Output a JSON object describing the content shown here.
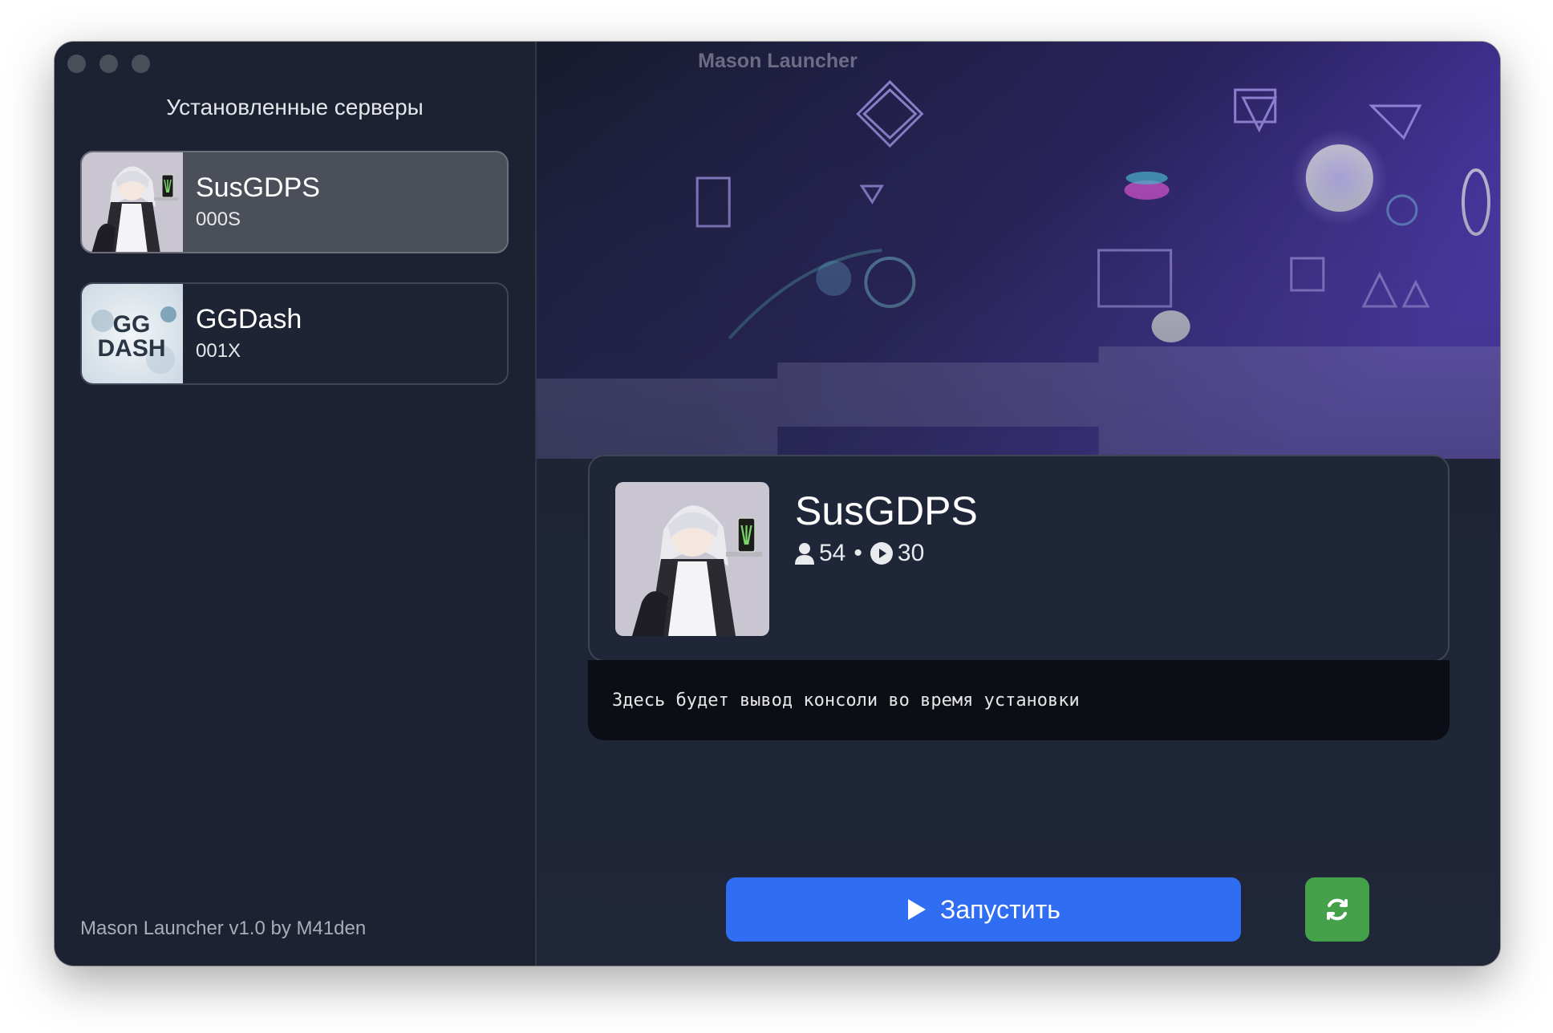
{
  "window": {
    "title": "Mason Launcher"
  },
  "sidebar": {
    "title": "Установленные серверы",
    "servers": [
      {
        "name": "SusGDPS",
        "code": "000S",
        "selected": true,
        "thumb": "maid-character-thumbnail"
      },
      {
        "name": "GGDash",
        "code": "001X",
        "selected": false,
        "thumb": "ggdash-logo-thumbnail",
        "logo_text": "GG DASH"
      }
    ],
    "footer": "Mason Launcher v1.0 by M41den"
  },
  "main": {
    "selected": {
      "name": "SusGDPS",
      "players": "54",
      "plays": "30",
      "separator": "•"
    },
    "console_text": "Здесь будет вывод консоли во время установки",
    "launch_label": "Запустить"
  },
  "colors": {
    "launch": "#2f6ef2",
    "refresh": "#44a049",
    "sidebar_bg": "#1c2231"
  }
}
